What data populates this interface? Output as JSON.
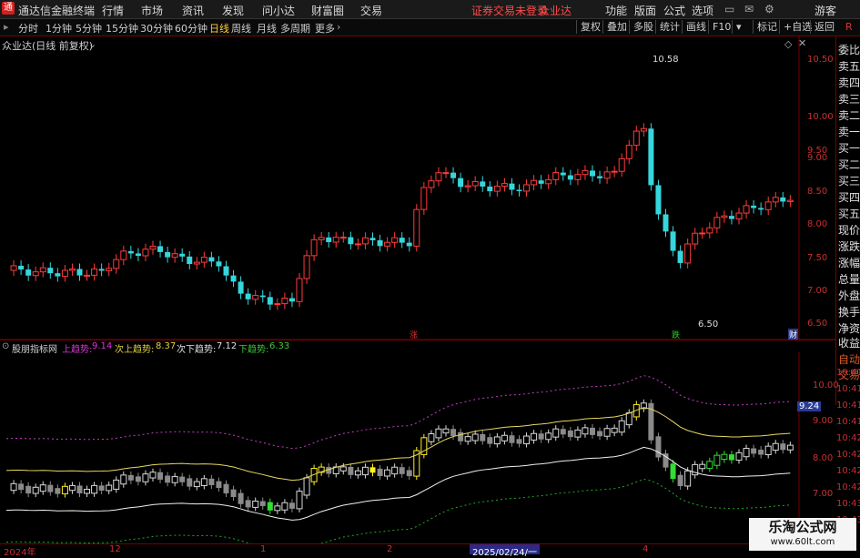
{
  "titlebar": {
    "app_name": "通达信金融终端",
    "menu": [
      "行情",
      "市场",
      "资讯",
      "发现",
      "问小达",
      "财富圈",
      "交易"
    ],
    "notice": "证券交易未登录",
    "stock": "众业达",
    "right_menu": [
      "功能",
      "版面",
      "公式",
      "选项"
    ],
    "user": "游客"
  },
  "toolbar": {
    "periods": [
      "分时",
      "1分钟",
      "5分钟",
      "15分钟",
      "30分钟",
      "60分钟",
      "日线",
      "周线",
      "月线",
      "多周期",
      "更多"
    ],
    "active_period": "日线",
    "right_buttons": [
      "复权",
      "叠加",
      "多股",
      "统计",
      "画线",
      "F10",
      "标记",
      "+自选",
      "返回"
    ]
  },
  "chart": {
    "title": "众业达(日线 前复权)",
    "yticks": [
      "10.50",
      "10.00",
      "9.50",
      "9.00",
      "8.50",
      "8.00",
      "7.50",
      "7.00",
      "6.50"
    ],
    "high_label": "10.58",
    "low_label": "6.50",
    "markers": [
      "涨",
      "跌",
      "财"
    ],
    "colors": {
      "up": "#ff3b3b",
      "down": "#35d6dc",
      "axis": "#c83030"
    }
  },
  "right_panel": {
    "items": [
      "委比",
      "卖五",
      "卖四",
      "卖三",
      "卖二",
      "卖一",
      "买一",
      "买二",
      "买三",
      "买四",
      "买五",
      "现价",
      "涨跌",
      "涨幅",
      "总量",
      "外盘",
      "换手",
      "净资",
      "收益"
    ],
    "bottom_items": [
      "自动",
      "交易"
    ]
  },
  "indicator": {
    "name": "股朋指标网",
    "line1_label": "上趋势:",
    "line1_value": "9.14",
    "line2_label": "次上趋势:",
    "line2_value": "8.37",
    "line3_label": "次下趋势:",
    "line3_value": "7.12",
    "line4_label": "下趋势:",
    "line4_value": "6.33",
    "yticks": [
      "10.00",
      "9.00",
      "8.00",
      "7.00"
    ],
    "right_ticks": [
      "10:41",
      "10:41",
      "10:41",
      "10:41",
      "10:42",
      "10:42",
      "10:42",
      "10:42",
      "10:43",
      "10:43"
    ],
    "current_value": "9.24"
  },
  "xaxis": {
    "labels": [
      "2024年",
      "12",
      "1",
      "2",
      "4"
    ],
    "date_badge": "2025/02/24/一"
  },
  "watermark": {
    "line1": "乐淘公式网",
    "line2": "www.60lt.com"
  }
}
